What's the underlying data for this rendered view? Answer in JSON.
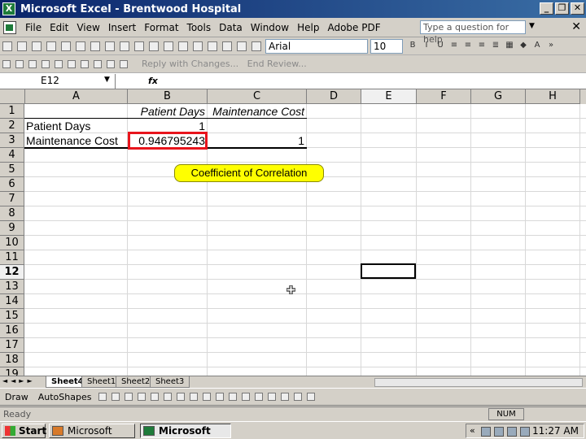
{
  "window": {
    "title": "Microsoft Excel - Brentwood Hospital",
    "app_icon": "X"
  },
  "menu": {
    "items": [
      "File",
      "Edit",
      "View",
      "Insert",
      "Format",
      "Tools",
      "Data",
      "Window",
      "Help",
      "Adobe PDF"
    ],
    "help_placeholder": "Type a question for help"
  },
  "formatting": {
    "font": "Arial",
    "size": "10"
  },
  "review_toolbar": {
    "reply_label": "Reply with Changes...",
    "end_review_label": "End Review..."
  },
  "formula_bar": {
    "name_box": "E12",
    "fx": "fx"
  },
  "columns": [
    "A",
    "B",
    "C",
    "D",
    "E",
    "F",
    "G",
    "H"
  ],
  "rows": [
    "1",
    "2",
    "3",
    "4",
    "5",
    "6",
    "7",
    "8",
    "9",
    "10",
    "11",
    "12",
    "13",
    "14",
    "15",
    "16",
    "17",
    "18",
    "19"
  ],
  "cells": {
    "B1": "Patient Days",
    "C1": "Maintenance Cost",
    "A2": "Patient Days",
    "B2": "1",
    "A3": "Maintenance Cost",
    "B3": "0.946795243",
    "C3": "1"
  },
  "callout": {
    "text": "Coefficient of Correlation"
  },
  "sheets": {
    "tabs": [
      "Sheet4",
      "Sheet1",
      "Sheet2",
      "Sheet3"
    ],
    "active": "Sheet4"
  },
  "draw_toolbar": {
    "draw_label": "Draw",
    "autoshapes_label": "AutoShapes"
  },
  "status": {
    "text": "Ready",
    "num": "NUM"
  },
  "taskbar": {
    "start": "Start",
    "tasks": [
      "Microsoft Po...",
      "Microsoft E..."
    ],
    "clock": "11:27 AM"
  },
  "colors": {
    "highlight_border": "#e8141c",
    "callout_fill": "#ffff00",
    "titlebar": "#0a246a"
  }
}
